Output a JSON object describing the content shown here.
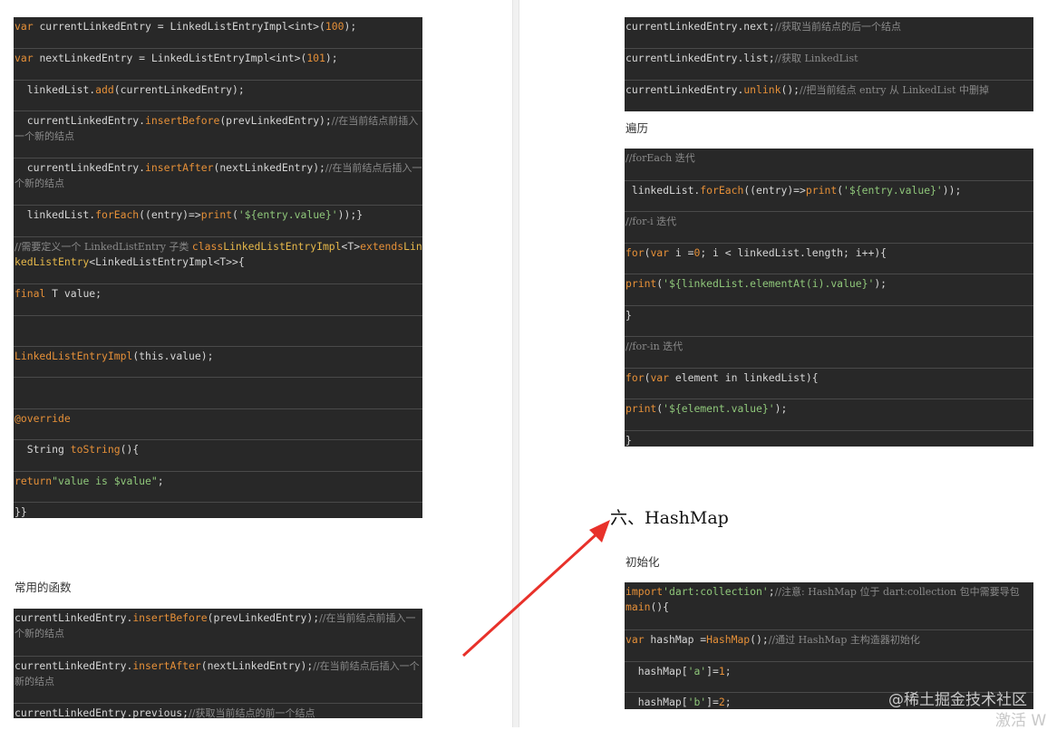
{
  "left_column": {
    "block1_rows": [
      [
        [
          "kw",
          "var "
        ],
        [
          "pu",
          "currentLinkedEntry = LinkedListEntryImpl<int>("
        ],
        [
          "num",
          "100"
        ],
        [
          "pu",
          ");"
        ]
      ],
      [
        [
          "kw",
          "var "
        ],
        [
          "pu",
          "nextLinkedEntry = LinkedListEntryImpl<int>("
        ],
        [
          "num",
          "101"
        ],
        [
          "pu",
          ");"
        ]
      ],
      [
        [
          "pu",
          "  linkedList."
        ],
        [
          "fn",
          "add"
        ],
        [
          "pu",
          "(currentLinkedEntry);"
        ]
      ],
      [
        [
          "pu",
          "  currentLinkedEntry."
        ],
        [
          "fn",
          "insertBefore"
        ],
        [
          "pu",
          "(prevLinkedEntry);"
        ],
        [
          "cm",
          "//在当前结点前插入一个新的结点"
        ]
      ],
      [
        [
          "pu",
          "  currentLinkedEntry."
        ],
        [
          "fn",
          "insertAfter"
        ],
        [
          "pu",
          "(nextLinkedEntry);"
        ],
        [
          "cm",
          "//在当前结点后插入一个新的结点"
        ]
      ],
      [
        [
          "pu",
          "  linkedList."
        ],
        [
          "fn",
          "forEach"
        ],
        [
          "pu",
          "((entry)=>"
        ],
        [
          "fn",
          "print"
        ],
        [
          "pu",
          "("
        ],
        [
          "str",
          "'${entry.value}'"
        ],
        [
          "pu",
          "));}"
        ]
      ],
      [
        [
          "cm",
          "//需要定义一个 LinkedListEntry 子类 "
        ],
        [
          "kw",
          "class"
        ],
        [
          "ty",
          "LinkedListEntryImpl"
        ],
        [
          "pu",
          "<T>"
        ],
        [
          "kw",
          "extends"
        ],
        [
          "ty",
          "LinkedListEntry"
        ],
        [
          "pu",
          "<LinkedListEntryImpl<T>>{"
        ]
      ],
      [
        [
          "kw",
          "final "
        ],
        [
          "pu",
          "T value;"
        ]
      ],
      [
        [
          "pu",
          ""
        ]
      ],
      [
        [
          "fn",
          "LinkedListEntryImpl"
        ],
        [
          "pu",
          "(this.value);"
        ]
      ],
      [
        [
          "pu",
          ""
        ]
      ],
      [
        [
          "kw",
          "@override"
        ]
      ],
      [
        [
          "pu",
          "  String "
        ],
        [
          "fn",
          "toString"
        ],
        [
          "pu",
          "(){"
        ]
      ],
      [
        [
          "kw",
          "return"
        ],
        [
          "str",
          "\"value is $value\""
        ],
        [
          "pu",
          ";"
        ]
      ],
      [
        [
          "pu",
          "}}"
        ]
      ]
    ],
    "caption_common_functions": "常用的函数",
    "block2_rows": [
      [
        [
          "pu",
          "currentLinkedEntry."
        ],
        [
          "fn",
          "insertBefore"
        ],
        [
          "pu",
          "(prevLinkedEntry);"
        ],
        [
          "cm",
          "//在当前结点前插入一个新的结点"
        ]
      ],
      [
        [
          "pu",
          "currentLinkedEntry."
        ],
        [
          "fn",
          "insertAfter"
        ],
        [
          "pu",
          "(nextLinkedEntry);"
        ],
        [
          "cm",
          "//在当前结点后插入一个新的结点"
        ]
      ],
      [
        [
          "pu",
          "currentLinkedEntry.previous;"
        ],
        [
          "cm",
          "//获取当前结点的前一个结点"
        ]
      ]
    ]
  },
  "right_column": {
    "block3_rows": [
      [
        [
          "pu",
          "currentLinkedEntry.next;"
        ],
        [
          "cm",
          "//获取当前结点的后一个结点"
        ]
      ],
      [
        [
          "pu",
          "currentLinkedEntry.list;"
        ],
        [
          "cm",
          "//获取 LinkedList"
        ]
      ],
      [
        [
          "pu",
          "currentLinkedEntry."
        ],
        [
          "fn",
          "unlink"
        ],
        [
          "pu",
          "();"
        ],
        [
          "cm",
          "//把当前结点 entry 从 LinkedList 中删掉"
        ]
      ]
    ],
    "caption_traverse": "遍历",
    "block4_rows": [
      [
        [
          "cm",
          "//forEach 迭代"
        ]
      ],
      [
        [
          "pu",
          " linkedList."
        ],
        [
          "fn",
          "forEach"
        ],
        [
          "pu",
          "((entry)=>"
        ],
        [
          "fn",
          "print"
        ],
        [
          "pu",
          "("
        ],
        [
          "str",
          "'${entry.value}'"
        ],
        [
          "pu",
          "));"
        ]
      ],
      [
        [
          "cm",
          "//for-i 迭代"
        ]
      ],
      [
        [
          "kw",
          "for"
        ],
        [
          "pu",
          "("
        ],
        [
          "kw",
          "var"
        ],
        [
          "pu",
          " i ="
        ],
        [
          "num",
          "0"
        ],
        [
          "pu",
          "; i < linkedList.length; i++){"
        ]
      ],
      [
        [
          "fn",
          "print"
        ],
        [
          "pu",
          "("
        ],
        [
          "str",
          "'${linkedList.elementAt(i).value}'"
        ],
        [
          "pu",
          ");"
        ]
      ],
      [
        [
          "pu",
          "}"
        ]
      ],
      [
        [
          "cm",
          "//for-in 迭代"
        ]
      ],
      [
        [
          "kw",
          "for"
        ],
        [
          "pu",
          "("
        ],
        [
          "kw",
          "var"
        ],
        [
          "pu",
          " element in linkedList){"
        ]
      ],
      [
        [
          "fn",
          "print"
        ],
        [
          "pu",
          "("
        ],
        [
          "str",
          "'${element.value}'"
        ],
        [
          "pu",
          ");"
        ]
      ],
      [
        [
          "pu",
          "}"
        ]
      ]
    ],
    "heading_hashmap": "六、HashMap",
    "caption_init": "初始化",
    "block5_rows": [
      [
        [
          "kw",
          "import"
        ],
        [
          "str",
          "'dart:collection'"
        ],
        [
          "pu",
          ";"
        ],
        [
          "cm",
          "//注意: HashMap 位于 dart:collection 包中需要导包"
        ],
        [
          "pu",
          "\n"
        ],
        [
          "fn",
          "main"
        ],
        [
          "pu",
          "(){"
        ]
      ],
      [
        [
          "kw",
          "var"
        ],
        [
          "pu",
          " hashMap ="
        ],
        [
          "fn",
          "HashMap"
        ],
        [
          "pu",
          "();"
        ],
        [
          "cm",
          "//通过 HashMap 主构造器初始化"
        ]
      ],
      [
        [
          "pu",
          "  hashMap["
        ],
        [
          "str",
          "'a'"
        ],
        [
          "pu",
          "]="
        ],
        [
          "num",
          "1"
        ],
        [
          "pu",
          ";"
        ]
      ],
      [
        [
          "pu",
          "  hashMap["
        ],
        [
          "str",
          "'b'"
        ],
        [
          "pu",
          "]="
        ],
        [
          "num",
          "2"
        ],
        [
          "pu",
          ";"
        ]
      ]
    ]
  },
  "watermark": {
    "line1": "@稀土掘金技术社区",
    "line2": "激活 W"
  },
  "colors": {
    "code_bg": "#282828",
    "keyword": "#e69038",
    "string": "#8fc77a",
    "comment": "#8a8a8a",
    "arrow": "#e8312a"
  }
}
